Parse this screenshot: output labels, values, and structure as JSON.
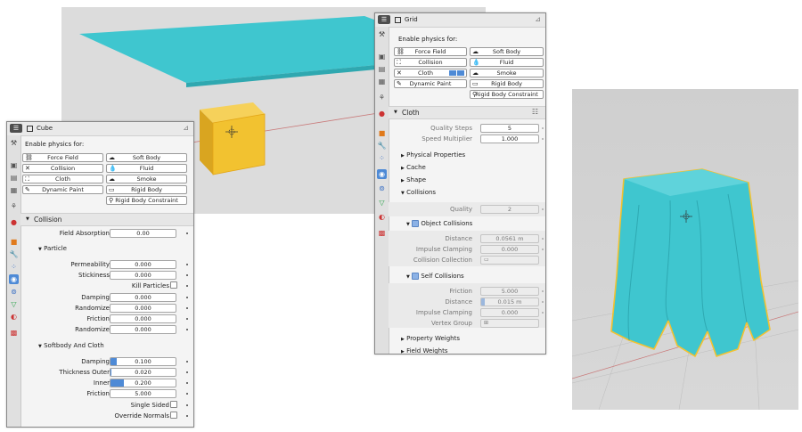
{
  "left_panel": {
    "object_name": "Cube",
    "enable_label": "Enable physics for:",
    "physics_buttons": [
      {
        "label": "Force Field",
        "icon": "force-field-icon"
      },
      {
        "label": "Soft Body",
        "icon": "soft-body-icon"
      },
      {
        "label": "Collision",
        "icon": "collision-x-icon"
      },
      {
        "label": "Fluid",
        "icon": "fluid-icon"
      },
      {
        "label": "Cloth",
        "icon": "cloth-icon"
      },
      {
        "label": "Smoke",
        "icon": "smoke-icon"
      },
      {
        "label": "Dynamic Paint",
        "icon": "dynamic-paint-icon"
      },
      {
        "label": "Rigid Body",
        "icon": "rigid-body-icon"
      },
      {
        "label": "Rigid Body Constraint",
        "icon": "rigid-body-constraint-icon"
      }
    ],
    "collision": {
      "title": "Collision",
      "field_absorption_label": "Field Absorption",
      "field_absorption_value": "0.00",
      "particle": {
        "title": "Particle",
        "permeability_label": "Permeability",
        "permeability_value": "0.000",
        "stickiness_label": "Stickiness",
        "stickiness_value": "0.000",
        "kill_particles_label": "Kill Particles",
        "damping_label": "Damping",
        "damping_value": "0.000",
        "randomize1_label": "Randomize",
        "randomize1_value": "0.000",
        "friction_label": "Friction",
        "friction_value": "0.000",
        "randomize2_label": "Randomize",
        "randomize2_value": "0.000"
      },
      "softbody": {
        "title": "Softbody And Cloth",
        "damping_label": "Damping",
        "damping_value": "0.100",
        "damping_fill": 0.1,
        "thickness_outer_label": "Thickness Outer",
        "thickness_outer_value": "0.020",
        "thickness_outer_fill": 0.02,
        "inner_label": "Inner",
        "inner_value": "0.200",
        "inner_fill": 0.2,
        "friction_label": "Friction",
        "friction_value": "5.000",
        "single_sided_label": "Single Sided",
        "override_normals_label": "Override Normals"
      }
    }
  },
  "right_panel": {
    "object_name": "Grid",
    "enable_label": "Enable physics for:",
    "physics_buttons": [
      {
        "label": "Force Field",
        "icon": "force-field-icon"
      },
      {
        "label": "Soft Body",
        "icon": "soft-body-icon"
      },
      {
        "label": "Collision",
        "icon": "collision-icon"
      },
      {
        "label": "Fluid",
        "icon": "fluid-icon"
      },
      {
        "label": "Cloth",
        "icon": "cloth-x-icon"
      },
      {
        "label": "Smoke",
        "icon": "smoke-icon"
      },
      {
        "label": "Dynamic Paint",
        "icon": "dynamic-paint-icon"
      },
      {
        "label": "Rigid Body",
        "icon": "rigid-body-icon"
      },
      {
        "label": "Rigid Body Constraint",
        "icon": "rigid-body-constraint-icon"
      }
    ],
    "cloth": {
      "title": "Cloth",
      "quality_steps_label": "Quality Steps",
      "quality_steps_value": "5",
      "speed_multiplier_label": "Speed Multiplier",
      "speed_multiplier_value": "1.000",
      "physical_properties_label": "Physical Properties",
      "cache_label": "Cache",
      "shape_label": "Shape",
      "collisions": {
        "title": "Collisions",
        "quality_label": "Quality",
        "quality_value": "2",
        "object_collisions": {
          "title": "Object Collisions",
          "distance_label": "Distance",
          "distance_value": "0.0561 m",
          "impulse_clamping_label": "Impulse Clamping",
          "impulse_clamping_value": "0.000",
          "collision_collection_label": "Collision Collection"
        },
        "self_collisions": {
          "title": "Self Collisions",
          "friction_label": "Friction",
          "friction_value": "5.000",
          "distance_label": "Distance",
          "distance_value": "0.015 m",
          "impulse_clamping_label": "Impulse Clamping",
          "impulse_clamping_value": "0.000",
          "vertex_group_label": "Vertex Group"
        }
      },
      "property_weights_label": "Property Weights",
      "field_weights_label": "Field Weights"
    }
  },
  "colors": {
    "cloth_cyan": "#3fc6cf",
    "cube_yellow": "#f2c230",
    "accent_blue": "#4e8ad6"
  }
}
